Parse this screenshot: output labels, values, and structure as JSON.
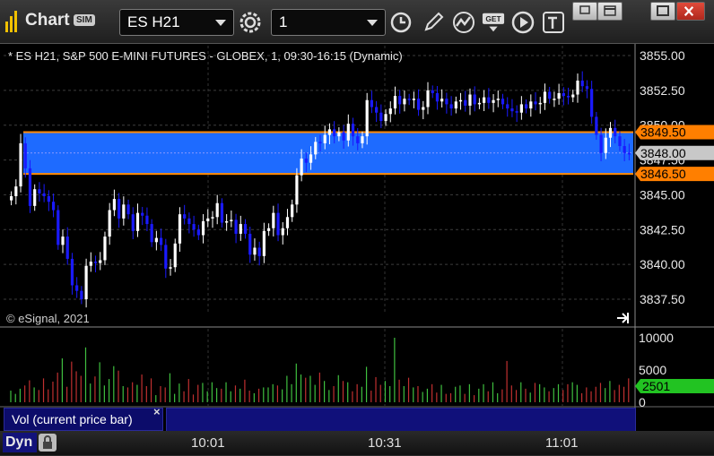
{
  "window": {
    "app_title": "Chart",
    "sim_badge": "SIM",
    "symbol": "ES H21",
    "interval": "1",
    "icons": [
      "clock-icon",
      "pencil-draw-icon",
      "indicator-icon",
      "get-data-icon",
      "play-icon",
      "text-tool-icon",
      "settings-gear-icon"
    ],
    "window_buttons": [
      "restore-icon",
      "tile-icon",
      "maximize-icon",
      "close-icon"
    ]
  },
  "chart_data": {
    "type": "candlestick",
    "title": "* ES H21, S&P 500 E-MINI FUTURES - GLOBEX, 1, 09:30-16:15 (Dynamic)",
    "copyright": "© eSignal, 2021",
    "x_tick_labels": [
      "10:01",
      "10:31",
      "11:01"
    ],
    "price_axis": {
      "range": [
        3835.75,
        3856.0
      ],
      "tick_labels": [
        "3855.00",
        "3852.50",
        "3850.00",
        "3847.50",
        "3845.00",
        "3842.50",
        "3840.00",
        "3837.50"
      ],
      "grid": true
    },
    "price_band": {
      "upper": 3849.5,
      "lower": 3846.5,
      "upper_label": "3849.50",
      "lower_label": "3846.50",
      "color": "#1e6bff",
      "line_color": "#ff8a00"
    },
    "current_price_label": "3848.00",
    "bar_close_colors": {
      "up": "#ffffff",
      "down": "#1a1aff"
    },
    "closes": [
      3844.9,
      3845.6,
      3848.7,
      3846.9,
      3844.2,
      3845.4,
      3845.1,
      3844.9,
      3844.5,
      3843.9,
      3841.4,
      3842.0,
      3840.4,
      3838.5,
      3838.1,
      3837.5,
      3839.9,
      3840.2,
      3840.1,
      3840.3,
      3842.0,
      3843.9,
      3844.7,
      3843.3,
      3844.3,
      3843.6,
      3842.4,
      3843.7,
      3843.5,
      3842.9,
      3841.6,
      3841.9,
      3841.4,
      3839.7,
      3839.8,
      3841.5,
      3843.6,
      3843.3,
      3842.9,
      3842.5,
      3842.1,
      3843.1,
      3843.3,
      3843.4,
      3844.4,
      3843.0,
      3843.1,
      3843.2,
      3842.2,
      3842.9,
      3842.2,
      3840.7,
      3841.2,
      3840.6,
      3842.4,
      3842.6,
      3843.7,
      3842.1,
      3842.6,
      3843.4,
      3844.3,
      3846.4,
      3847.6,
      3847.3,
      3847.9,
      3848.8,
      3848.7,
      3849.3,
      3849.7,
      3849.2,
      3849.5,
      3848.9,
      3850.1,
      3849.2,
      3848.7,
      3849.2,
      3851.8,
      3851.3,
      3850.9,
      3850.3,
      3850.8,
      3851.2,
      3852.1,
      3851.5,
      3851.9,
      3851.8,
      3851.9,
      3851.1,
      3851.3,
      3852.5,
      3852.3,
      3851.7,
      3851.9,
      3851.5,
      3851.2,
      3851.7,
      3851.8,
      3851.4,
      3852.2,
      3851.5,
      3851.6,
      3852.0,
      3851.6,
      3851.8,
      3851.9,
      3851.5,
      3851.2,
      3851.0,
      3850.9,
      3851.5,
      3851.2,
      3851.7,
      3851.5,
      3851.6,
      3852.4,
      3851.9,
      3851.9,
      3852.3,
      3852.1,
      3852.0,
      3852.2,
      3853.2,
      3852.8,
      3852.6,
      3850.6,
      3849.3,
      3848.0,
      3849.1,
      3849.8,
      3849.2,
      3848.5,
      3848.0,
      3847.9
    ],
    "volume_axis": {
      "range": [
        0,
        10000
      ],
      "tick_labels": [
        "10000",
        "5000",
        "0"
      ]
    },
    "volume_label": "Vol (current price bar)",
    "current_volume_label": "2501",
    "volumes": [
      1800,
      1300,
      2100,
      2600,
      3400,
      2300,
      1900,
      3700,
      2000,
      3200,
      4600,
      6800,
      2400,
      6300,
      4800,
      4100,
      8500,
      2900,
      4000,
      6200,
      2600,
      3600,
      5600,
      4900,
      2500,
      2300,
      3100,
      2700,
      4300,
      2500,
      3700,
      1100,
      2500,
      2300,
      4500,
      1300,
      2900,
      1700,
      3600,
      1200,
      2700,
      3000,
      1700,
      3100,
      2200,
      2100,
      3100,
      1700,
      2600,
      2100,
      3500,
      1800,
      1400,
      2100,
      2300,
      2300,
      2800,
      2600,
      2000,
      4100,
      2800,
      6000,
      4300,
      3800,
      4100,
      2700,
      4600,
      3300,
      1900,
      2500,
      4200,
      3300,
      3100,
      1700,
      2800,
      2400,
      5500,
      1800,
      3900,
      2700,
      3300,
      2500,
      10000,
      3500,
      2500,
      3800,
      2300,
      2500,
      1600,
      2100,
      2800,
      1500,
      2700,
      1300,
      1400,
      2400,
      2600,
      1300,
      2800,
      1100,
      2100,
      2800,
      1700,
      3100,
      1400,
      2000,
      6400,
      2600,
      1900,
      3100,
      2100,
      1500,
      3000,
      2800,
      2300,
      1700,
      2200,
      2800,
      1900,
      2800,
      3100,
      2700,
      1400,
      2300,
      1700,
      2400,
      3000,
      2200,
      3300,
      1900,
      2700,
      2400,
      3700
    ]
  },
  "bottom_bar": {
    "dyn_label": "Dyn"
  }
}
